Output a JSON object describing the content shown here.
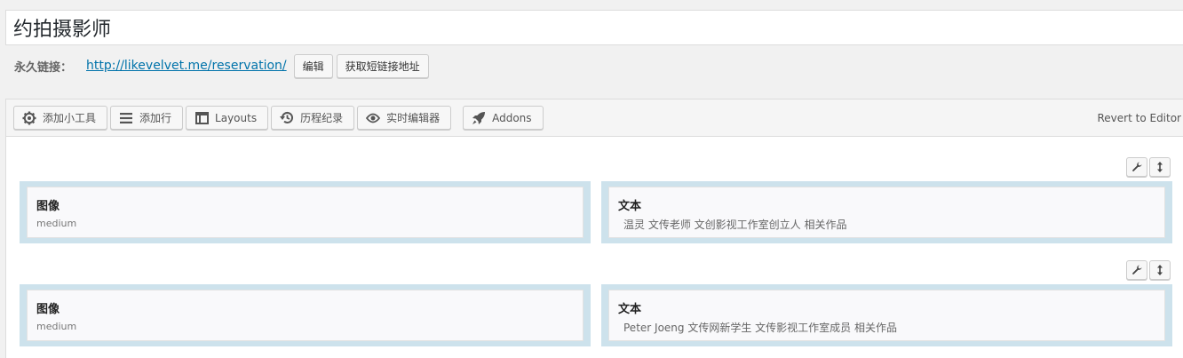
{
  "post": {
    "title": "约拍摄影师",
    "permalink_label": "永久链接：",
    "permalink_url": "http://likevelvet.me/reservation/",
    "edit_label": "编辑",
    "shortlink_label": "获取短链接地址"
  },
  "toolbar": {
    "buttons": [
      {
        "label": "添加小工具",
        "icon": "gear-icon"
      },
      {
        "label": "添加行",
        "icon": "menu-lines-icon"
      },
      {
        "label": "Layouts",
        "icon": "layout-icon"
      },
      {
        "label": "历程纪录",
        "icon": "history-icon"
      },
      {
        "label": "实时编辑器",
        "icon": "eye-icon"
      },
      {
        "label": "Addons",
        "icon": "rocket-icon"
      }
    ],
    "revert_label": "Revert to Editor"
  },
  "rows": [
    {
      "cells": [
        {
          "title": "图像",
          "desc": "medium"
        },
        {
          "title": "文本",
          "desc": "温灵 文传老师 文创影视工作室创立人 相关作品"
        }
      ]
    },
    {
      "cells": [
        {
          "title": "图像",
          "desc": "medium"
        },
        {
          "title": "文本",
          "desc": "Peter Joeng 文传网新学生 文传影视工作室成员 相关作品"
        }
      ]
    }
  ]
}
